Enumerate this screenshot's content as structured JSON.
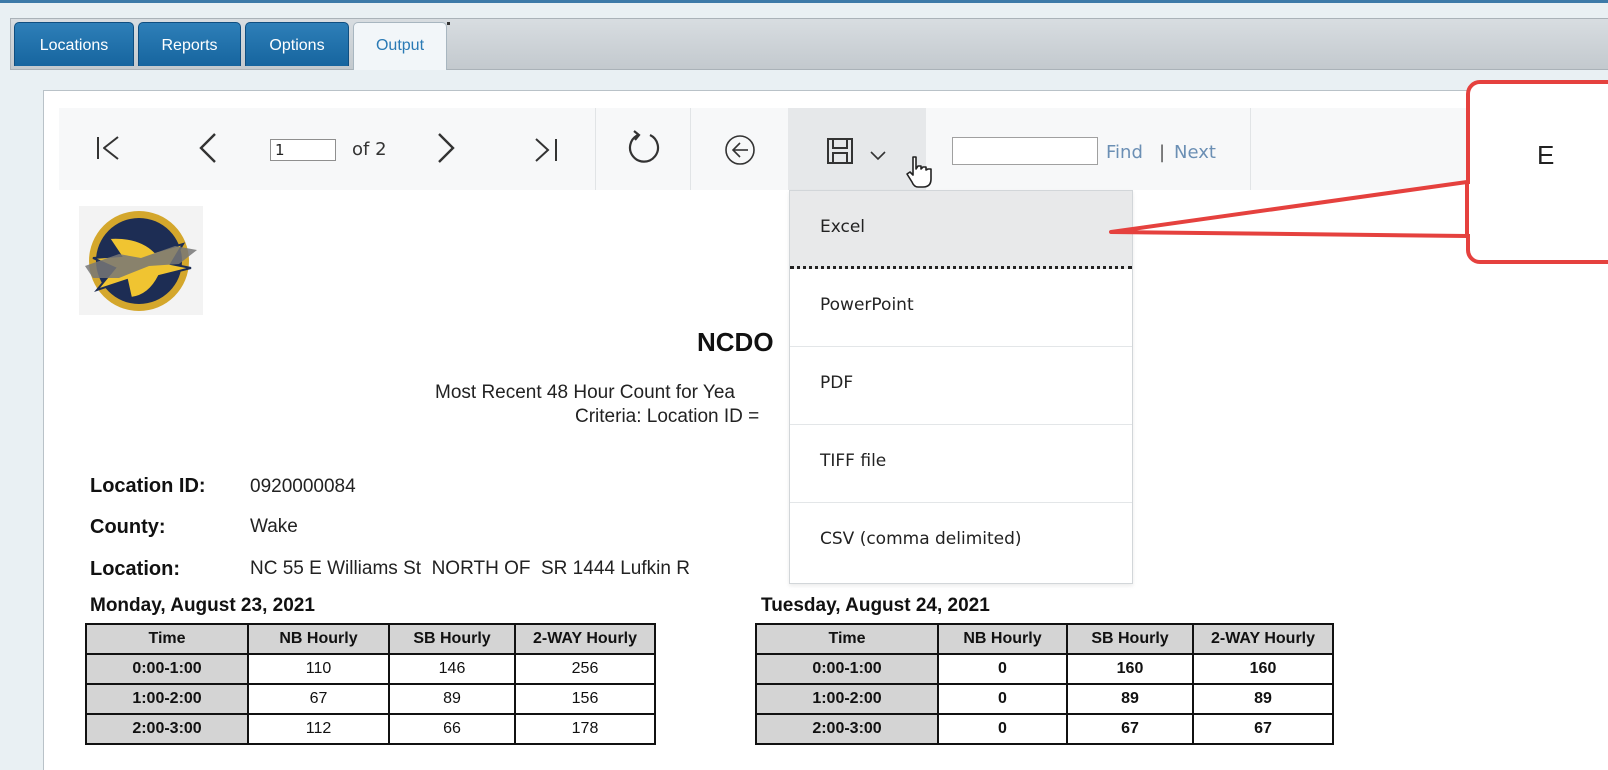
{
  "tabs": [
    {
      "label": "Locations"
    },
    {
      "label": "Reports"
    },
    {
      "label": "Options"
    },
    {
      "label": "Output"
    }
  ],
  "toolbar": {
    "page_current": "1",
    "page_total_text": "of 2",
    "find_label": "Find",
    "separator": "|",
    "next_label": "Next"
  },
  "export_menu": {
    "items": [
      {
        "label": "Excel"
      },
      {
        "label": "PowerPoint"
      },
      {
        "label": "PDF"
      },
      {
        "label": "TIFF file"
      },
      {
        "label": "CSV (comma delimited)"
      }
    ]
  },
  "callout": {
    "text": "E"
  },
  "colors": {
    "tab_blue": "#1d6fa9",
    "callout_red": "#e5413e"
  },
  "report": {
    "title": "NCDO",
    "subtitle1": "Most Recent 48 Hour Count for Yea",
    "subtitle2": "Criteria: Location ID =",
    "fields": [
      {
        "label": "Location ID:",
        "value": "0920000084"
      },
      {
        "label": "County:",
        "value": "Wake"
      },
      {
        "label": "Location:",
        "value": "NC 55 E Williams St  NORTH OF  SR 1444 Lufkin R"
      }
    ],
    "days": [
      {
        "title": "Monday, August 23, 2021",
        "headers": [
          "Time",
          "NB Hourly",
          "SB Hourly",
          "2-WAY Hourly"
        ],
        "rows": [
          [
            "0:00-1:00",
            "110",
            "146",
            "256"
          ],
          [
            "1:00-2:00",
            "67",
            "89",
            "156"
          ],
          [
            "2:00-3:00",
            "112",
            "66",
            "178"
          ]
        ]
      },
      {
        "title": "Tuesday, August 24, 2021",
        "headers": [
          "Time",
          "NB Hourly",
          "SB Hourly",
          "2-WAY Hourly"
        ],
        "rows": [
          [
            "0:00-1:00",
            "0",
            "160",
            "160"
          ],
          [
            "1:00-2:00",
            "0",
            "89",
            "89"
          ],
          [
            "2:00-3:00",
            "0",
            "67",
            "67"
          ]
        ]
      }
    ]
  }
}
